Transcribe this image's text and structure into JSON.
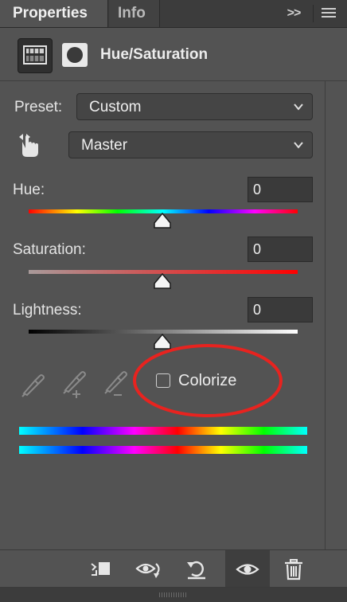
{
  "tabs": [
    {
      "label": "Properties",
      "active": true
    },
    {
      "label": "Info",
      "active": false
    }
  ],
  "panel_menu": {
    "collapse_label": ">>",
    "menu_icon": "hamburger-icon"
  },
  "header": {
    "title": "Hue/Saturation",
    "adjustment_icon": "hue-saturation-icon",
    "mask_icon": "layer-mask-icon"
  },
  "preset": {
    "label": "Preset:",
    "value": "Custom"
  },
  "channel": {
    "value": "Master",
    "tool_icon": "targeted-adjustment-hand-icon"
  },
  "sliders": [
    {
      "label": "Hue:",
      "value": "0"
    },
    {
      "label": "Saturation:",
      "value": "0"
    },
    {
      "label": "Lightness:",
      "value": "0"
    }
  ],
  "eyedroppers": [
    "eyedropper-icon",
    "eyedropper-add-icon",
    "eyedropper-subtract-icon"
  ],
  "colorize": {
    "label": "Colorize",
    "checked": false
  },
  "annotation_color": "#e8231f",
  "bottom_toolbar": [
    "clip-to-layer-icon",
    "view-previous-state-icon",
    "reset-icon",
    "toggle-visibility-icon",
    "delete-icon"
  ]
}
